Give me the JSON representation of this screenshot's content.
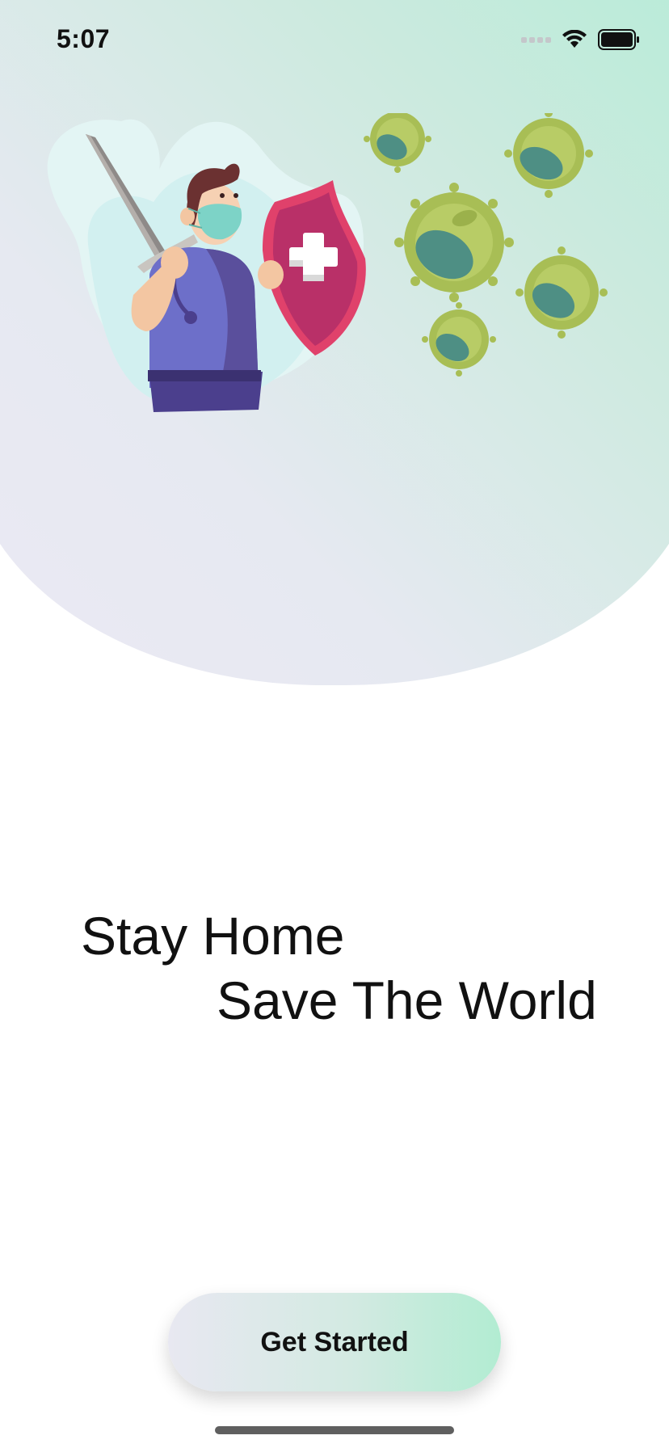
{
  "status_bar": {
    "time": "5:07"
  },
  "headline": {
    "line1": "Stay Home",
    "line2": "Save The World"
  },
  "cta": {
    "label": "Get Started"
  },
  "colors": {
    "hero_gradient_start": "#b2ecd6",
    "hero_gradient_end": "#ebe9f4",
    "button_gradient_start": "#e8e8f1",
    "button_gradient_end": "#b2ecd2",
    "text": "#111111"
  },
  "icons": [
    "signal-icon",
    "wifi-icon",
    "battery-icon",
    "hero-illustration",
    "virus-icon"
  ]
}
